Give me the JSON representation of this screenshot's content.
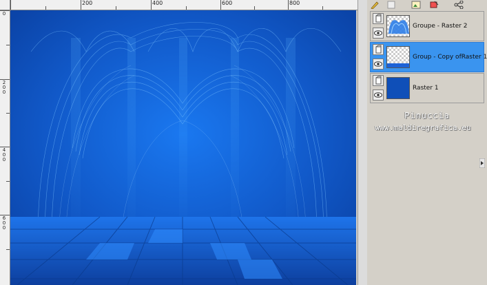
{
  "ruler": {
    "top_labels": [
      "200",
      "400",
      "600",
      "800"
    ],
    "left_labels": [
      "0",
      "2\n0\n0",
      "4\n0\n0",
      "6\n0\n0"
    ]
  },
  "canvas": {
    "description_colors": {
      "base": "#1159c9",
      "light": "#4aa8ff",
      "dark": "#0a3a8c"
    }
  },
  "toolbar": {
    "icons": [
      "brush-icon",
      "layer-icon",
      "image-icon",
      "paint-icon",
      "share-icon"
    ]
  },
  "layers": [
    {
      "name": "Groupe - Raster 2",
      "selected": false
    },
    {
      "name": "Group - Copy ofRaster 1",
      "selected": true
    },
    {
      "name": "Raster 1",
      "selected": false
    }
  ],
  "watermark": {
    "line1": "Pinuccia",
    "line2": "www.maldiregrafica.eu"
  }
}
